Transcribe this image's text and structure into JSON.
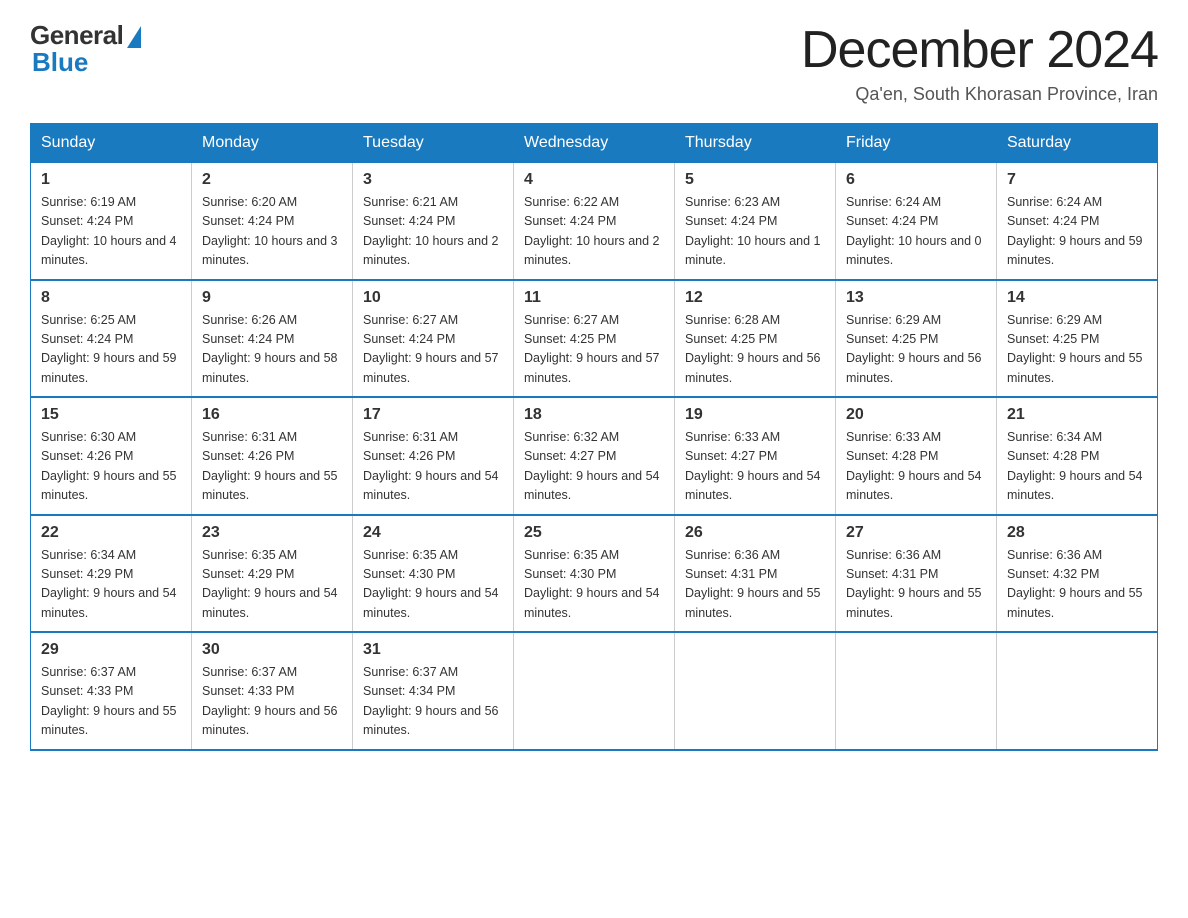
{
  "header": {
    "logo_general": "General",
    "logo_blue": "Blue",
    "month_title": "December 2024",
    "location": "Qa'en, South Khorasan Province, Iran"
  },
  "weekdays": [
    "Sunday",
    "Monday",
    "Tuesday",
    "Wednesday",
    "Thursday",
    "Friday",
    "Saturday"
  ],
  "weeks": [
    [
      {
        "day": "1",
        "sunrise": "6:19 AM",
        "sunset": "4:24 PM",
        "daylight": "10 hours and 4 minutes."
      },
      {
        "day": "2",
        "sunrise": "6:20 AM",
        "sunset": "4:24 PM",
        "daylight": "10 hours and 3 minutes."
      },
      {
        "day": "3",
        "sunrise": "6:21 AM",
        "sunset": "4:24 PM",
        "daylight": "10 hours and 2 minutes."
      },
      {
        "day": "4",
        "sunrise": "6:22 AM",
        "sunset": "4:24 PM",
        "daylight": "10 hours and 2 minutes."
      },
      {
        "day": "5",
        "sunrise": "6:23 AM",
        "sunset": "4:24 PM",
        "daylight": "10 hours and 1 minute."
      },
      {
        "day": "6",
        "sunrise": "6:24 AM",
        "sunset": "4:24 PM",
        "daylight": "10 hours and 0 minutes."
      },
      {
        "day": "7",
        "sunrise": "6:24 AM",
        "sunset": "4:24 PM",
        "daylight": "9 hours and 59 minutes."
      }
    ],
    [
      {
        "day": "8",
        "sunrise": "6:25 AM",
        "sunset": "4:24 PM",
        "daylight": "9 hours and 59 minutes."
      },
      {
        "day": "9",
        "sunrise": "6:26 AM",
        "sunset": "4:24 PM",
        "daylight": "9 hours and 58 minutes."
      },
      {
        "day": "10",
        "sunrise": "6:27 AM",
        "sunset": "4:24 PM",
        "daylight": "9 hours and 57 minutes."
      },
      {
        "day": "11",
        "sunrise": "6:27 AM",
        "sunset": "4:25 PM",
        "daylight": "9 hours and 57 minutes."
      },
      {
        "day": "12",
        "sunrise": "6:28 AM",
        "sunset": "4:25 PM",
        "daylight": "9 hours and 56 minutes."
      },
      {
        "day": "13",
        "sunrise": "6:29 AM",
        "sunset": "4:25 PM",
        "daylight": "9 hours and 56 minutes."
      },
      {
        "day": "14",
        "sunrise": "6:29 AM",
        "sunset": "4:25 PM",
        "daylight": "9 hours and 55 minutes."
      }
    ],
    [
      {
        "day": "15",
        "sunrise": "6:30 AM",
        "sunset": "4:26 PM",
        "daylight": "9 hours and 55 minutes."
      },
      {
        "day": "16",
        "sunrise": "6:31 AM",
        "sunset": "4:26 PM",
        "daylight": "9 hours and 55 minutes."
      },
      {
        "day": "17",
        "sunrise": "6:31 AM",
        "sunset": "4:26 PM",
        "daylight": "9 hours and 54 minutes."
      },
      {
        "day": "18",
        "sunrise": "6:32 AM",
        "sunset": "4:27 PM",
        "daylight": "9 hours and 54 minutes."
      },
      {
        "day": "19",
        "sunrise": "6:33 AM",
        "sunset": "4:27 PM",
        "daylight": "9 hours and 54 minutes."
      },
      {
        "day": "20",
        "sunrise": "6:33 AM",
        "sunset": "4:28 PM",
        "daylight": "9 hours and 54 minutes."
      },
      {
        "day": "21",
        "sunrise": "6:34 AM",
        "sunset": "4:28 PM",
        "daylight": "9 hours and 54 minutes."
      }
    ],
    [
      {
        "day": "22",
        "sunrise": "6:34 AM",
        "sunset": "4:29 PM",
        "daylight": "9 hours and 54 minutes."
      },
      {
        "day": "23",
        "sunrise": "6:35 AM",
        "sunset": "4:29 PM",
        "daylight": "9 hours and 54 minutes."
      },
      {
        "day": "24",
        "sunrise": "6:35 AM",
        "sunset": "4:30 PM",
        "daylight": "9 hours and 54 minutes."
      },
      {
        "day": "25",
        "sunrise": "6:35 AM",
        "sunset": "4:30 PM",
        "daylight": "9 hours and 54 minutes."
      },
      {
        "day": "26",
        "sunrise": "6:36 AM",
        "sunset": "4:31 PM",
        "daylight": "9 hours and 55 minutes."
      },
      {
        "day": "27",
        "sunrise": "6:36 AM",
        "sunset": "4:31 PM",
        "daylight": "9 hours and 55 minutes."
      },
      {
        "day": "28",
        "sunrise": "6:36 AM",
        "sunset": "4:32 PM",
        "daylight": "9 hours and 55 minutes."
      }
    ],
    [
      {
        "day": "29",
        "sunrise": "6:37 AM",
        "sunset": "4:33 PM",
        "daylight": "9 hours and 55 minutes."
      },
      {
        "day": "30",
        "sunrise": "6:37 AM",
        "sunset": "4:33 PM",
        "daylight": "9 hours and 56 minutes."
      },
      {
        "day": "31",
        "sunrise": "6:37 AM",
        "sunset": "4:34 PM",
        "daylight": "9 hours and 56 minutes."
      },
      null,
      null,
      null,
      null
    ]
  ]
}
